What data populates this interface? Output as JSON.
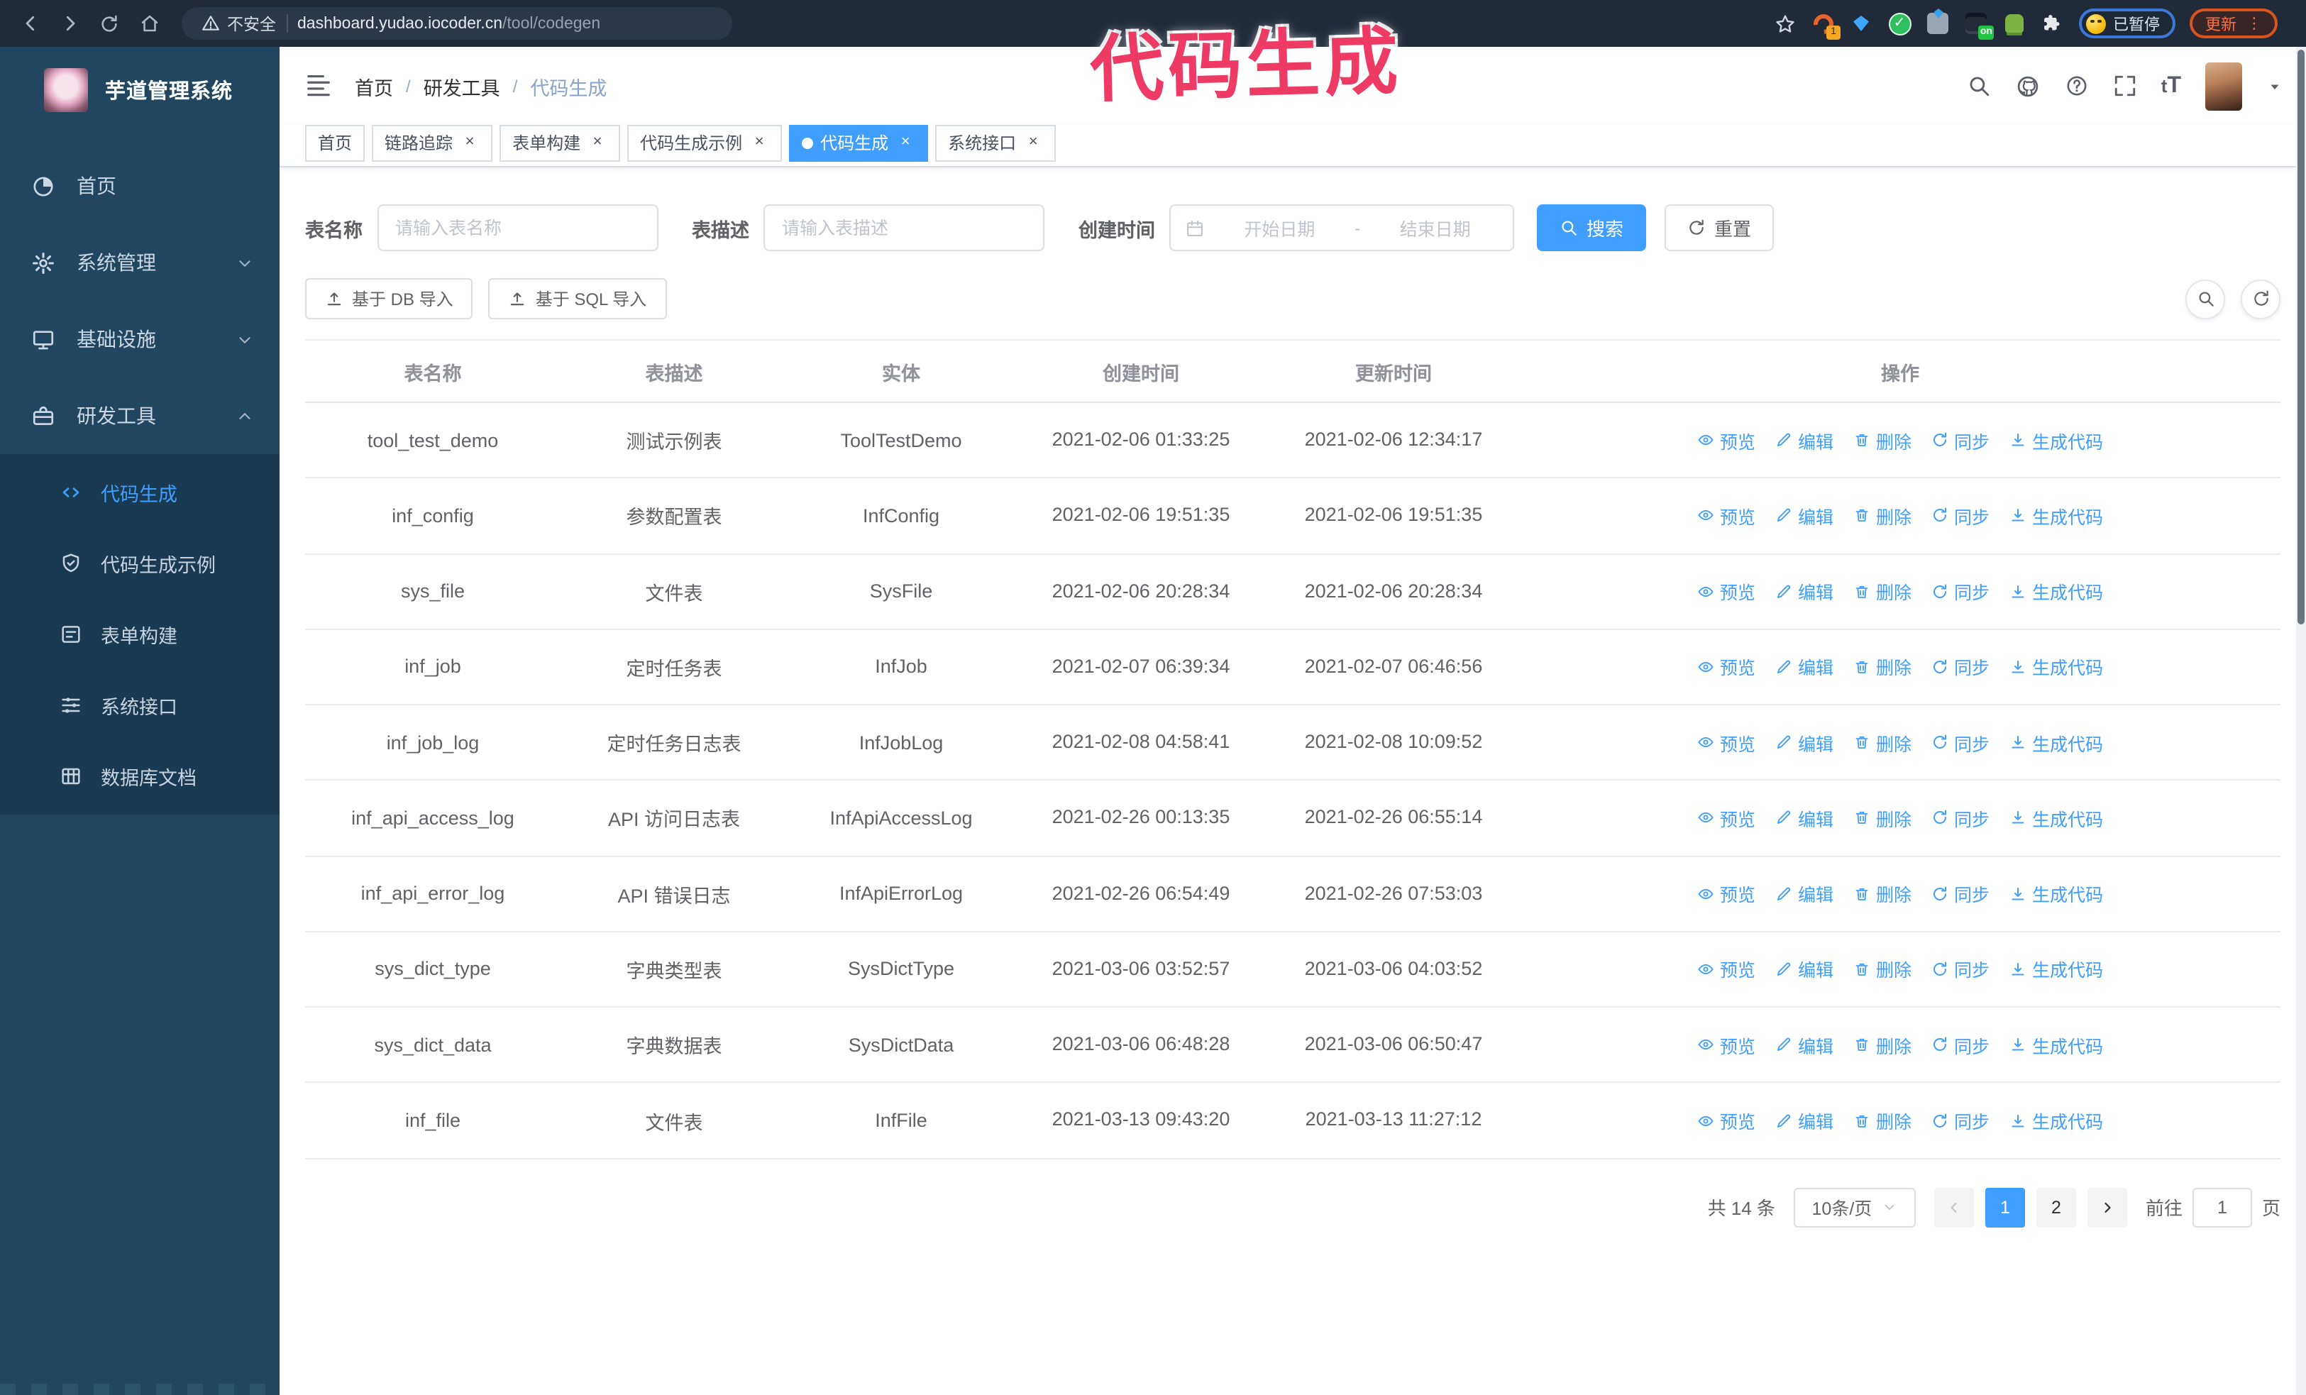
{
  "icons": {
    "close": "×",
    "star": "☆",
    "dots_vertical": "⋮",
    "caret_down": "▾",
    "check": "✓"
  },
  "browser": {
    "security_label": "不安全",
    "url_host": "dashboard.yudao.iocoder.cn",
    "url_path": "/tool/codegen",
    "ext_badge_count": "1",
    "ext_badge_on": "on",
    "paused_badge": "已暂停",
    "update_badge": "更新"
  },
  "annotation": "代码生成",
  "sidebar": {
    "title": "芋道管理系统",
    "items": [
      {
        "label": "首页"
      },
      {
        "label": "系统管理"
      },
      {
        "label": "基础设施"
      },
      {
        "label": "研发工具"
      }
    ],
    "subitems": [
      {
        "label": "代码生成"
      },
      {
        "label": "代码生成示例"
      },
      {
        "label": "表单构建"
      },
      {
        "label": "系统接口"
      },
      {
        "label": "数据库文档"
      }
    ]
  },
  "navbar": {
    "font_size_icon_small": "t",
    "font_size_icon_big": "T"
  },
  "breadcrumb": [
    "首页",
    "研发工具",
    "代码生成"
  ],
  "tabs": [
    {
      "label": "首页"
    },
    {
      "label": "链路追踪"
    },
    {
      "label": "表单构建"
    },
    {
      "label": "代码生成示例"
    },
    {
      "label": "代码生成"
    },
    {
      "label": "系统接口"
    }
  ],
  "search": {
    "name_label": "表名称",
    "name_placeholder": "请输入表名称",
    "desc_label": "表描述",
    "desc_placeholder": "请输入表描述",
    "time_label": "创建时间",
    "start_placeholder": "开始日期",
    "range_separator": "-",
    "end_placeholder": "结束日期",
    "search_button": "搜索",
    "reset_button": "重置"
  },
  "toolbar": {
    "import_db": "基于 DB 导入",
    "import_sql": "基于 SQL 导入"
  },
  "table": {
    "columns": [
      "表名称",
      "表描述",
      "实体",
      "创建时间",
      "更新时间",
      "操作"
    ],
    "actions": [
      "预览",
      "编辑",
      "删除",
      "同步",
      "生成代码"
    ],
    "rows": [
      {
        "name": "tool_test_demo",
        "desc": "测试示例表",
        "entity": "ToolTestDemo",
        "created": "2021-02-06 01:33:25",
        "updated": "2021-02-06 12:34:17"
      },
      {
        "name": "inf_config",
        "desc": "参数配置表",
        "entity": "InfConfig",
        "created": "2021-02-06 19:51:35",
        "updated": "2021-02-06 19:51:35"
      },
      {
        "name": "sys_file",
        "desc": "文件表",
        "entity": "SysFile",
        "created": "2021-02-06 20:28:34",
        "updated": "2021-02-06 20:28:34"
      },
      {
        "name": "inf_job",
        "desc": "定时任务表",
        "entity": "InfJob",
        "created": "2021-02-07 06:39:34",
        "updated": "2021-02-07 06:46:56"
      },
      {
        "name": "inf_job_log",
        "desc": "定时任务日志表",
        "entity": "InfJobLog",
        "created": "2021-02-08 04:58:41",
        "updated": "2021-02-08 10:09:52"
      },
      {
        "name": "inf_api_access_log",
        "desc": "API 访问日志表",
        "entity": "InfApiAccessLog",
        "created": "2021-02-26 00:13:35",
        "updated": "2021-02-26 06:55:14"
      },
      {
        "name": "inf_api_error_log",
        "desc": "API 错误日志",
        "entity": "InfApiErrorLog",
        "created": "2021-02-26 06:54:49",
        "updated": "2021-02-26 07:53:03"
      },
      {
        "name": "sys_dict_type",
        "desc": "字典类型表",
        "entity": "SysDictType",
        "created": "2021-03-06 03:52:57",
        "updated": "2021-03-06 04:03:52"
      },
      {
        "name": "sys_dict_data",
        "desc": "字典数据表",
        "entity": "SysDictData",
        "created": "2021-03-06 06:48:28",
        "updated": "2021-03-06 06:50:47"
      },
      {
        "name": "inf_file",
        "desc": "文件表",
        "entity": "InfFile",
        "created": "2021-03-13 09:43:20",
        "updated": "2021-03-13 11:27:12"
      }
    ]
  },
  "pagination": {
    "total": "共 14 条",
    "page_size": "10条/页",
    "pages": [
      "1",
      "2"
    ],
    "active_page": "1",
    "goto_label": "前往",
    "goto_value": "1",
    "page_suffix": "页"
  },
  "colors": {
    "primary": "#409eff",
    "sidebar_bg": "#21465f",
    "submenu_bg": "#1a3a52",
    "annotation": "#ee3b66",
    "browser_bar": "#202a38"
  }
}
